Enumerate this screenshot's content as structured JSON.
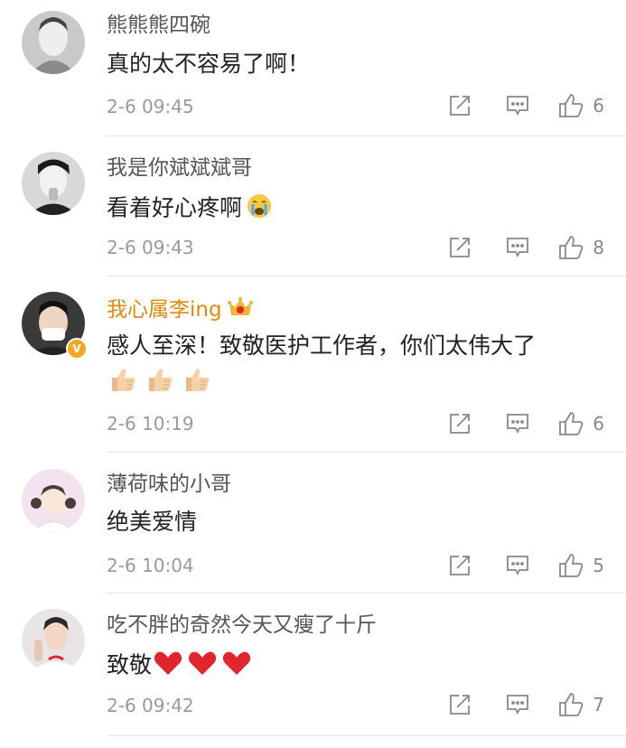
{
  "comments": [
    {
      "username": "熊熊熊四碗",
      "text": "真的太不容易了啊！",
      "time": "2-6 09:45",
      "likes": "6"
    },
    {
      "username": "我是你斌斌斌哥",
      "text": "看着好心疼啊",
      "emoji": "crying-face",
      "time": "2-6 09:43",
      "likes": "8"
    },
    {
      "username": "我心属李ing",
      "badge": "V",
      "text": "感人至深！致敬医护工作者，你们太伟大了",
      "emoji": "thumbs-up x3",
      "time": "2-6 10:19",
      "likes": "6",
      "name_color": "#e18a0b"
    },
    {
      "username": "薄荷味的小哥",
      "text": "绝美爱情",
      "time": "2-6 10:04",
      "likes": "5"
    },
    {
      "username": "吃不胖的奇然今天又瘦了十斤",
      "text": "致敬",
      "emoji": "red-heart x3",
      "time": "2-6 09:42",
      "likes": "7"
    }
  ],
  "icons": {
    "share": "share-icon",
    "comment": "comment-icon",
    "like": "thumbs-up-icon"
  },
  "colors": {
    "text": "#222222",
    "name": "#555555",
    "time": "#9a9a9a",
    "divider": "#e6e6e6",
    "vip_gold": "#e18a0b",
    "heart": "#e0252f"
  }
}
